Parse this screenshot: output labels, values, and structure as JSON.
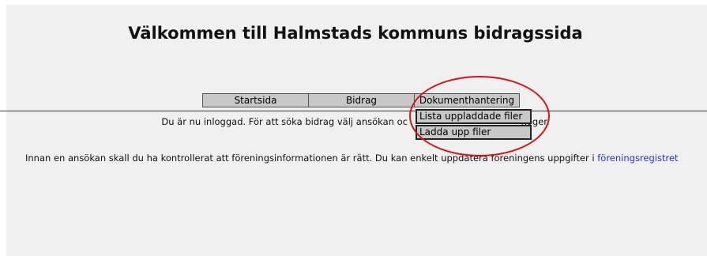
{
  "header": {
    "title": "Välkommen till Halmstads kommuns bidragssida"
  },
  "nav": {
    "tabs": [
      {
        "label": "Startsida"
      },
      {
        "label": "Bidrag"
      },
      {
        "label": "Dokumenthantering"
      }
    ],
    "dropdown": [
      {
        "label": "Lista uppladdade filer"
      },
      {
        "label": "Ladda upp filer"
      }
    ]
  },
  "main": {
    "login_text_start": "Du är nu inloggad. För att söka bidrag välj ansökan oc",
    "login_text_end": " höger.",
    "info_text": "Innan en ansökan skall du ha kontrollerat att föreningsinformationen är rätt. Du kan enkelt uppdatera föreningens uppgifter i ",
    "info_link": "föreningsregistret"
  },
  "colors": {
    "highlight": "#dd1111",
    "link": "#2233dd",
    "tab_bg": "#c8c8c8"
  }
}
